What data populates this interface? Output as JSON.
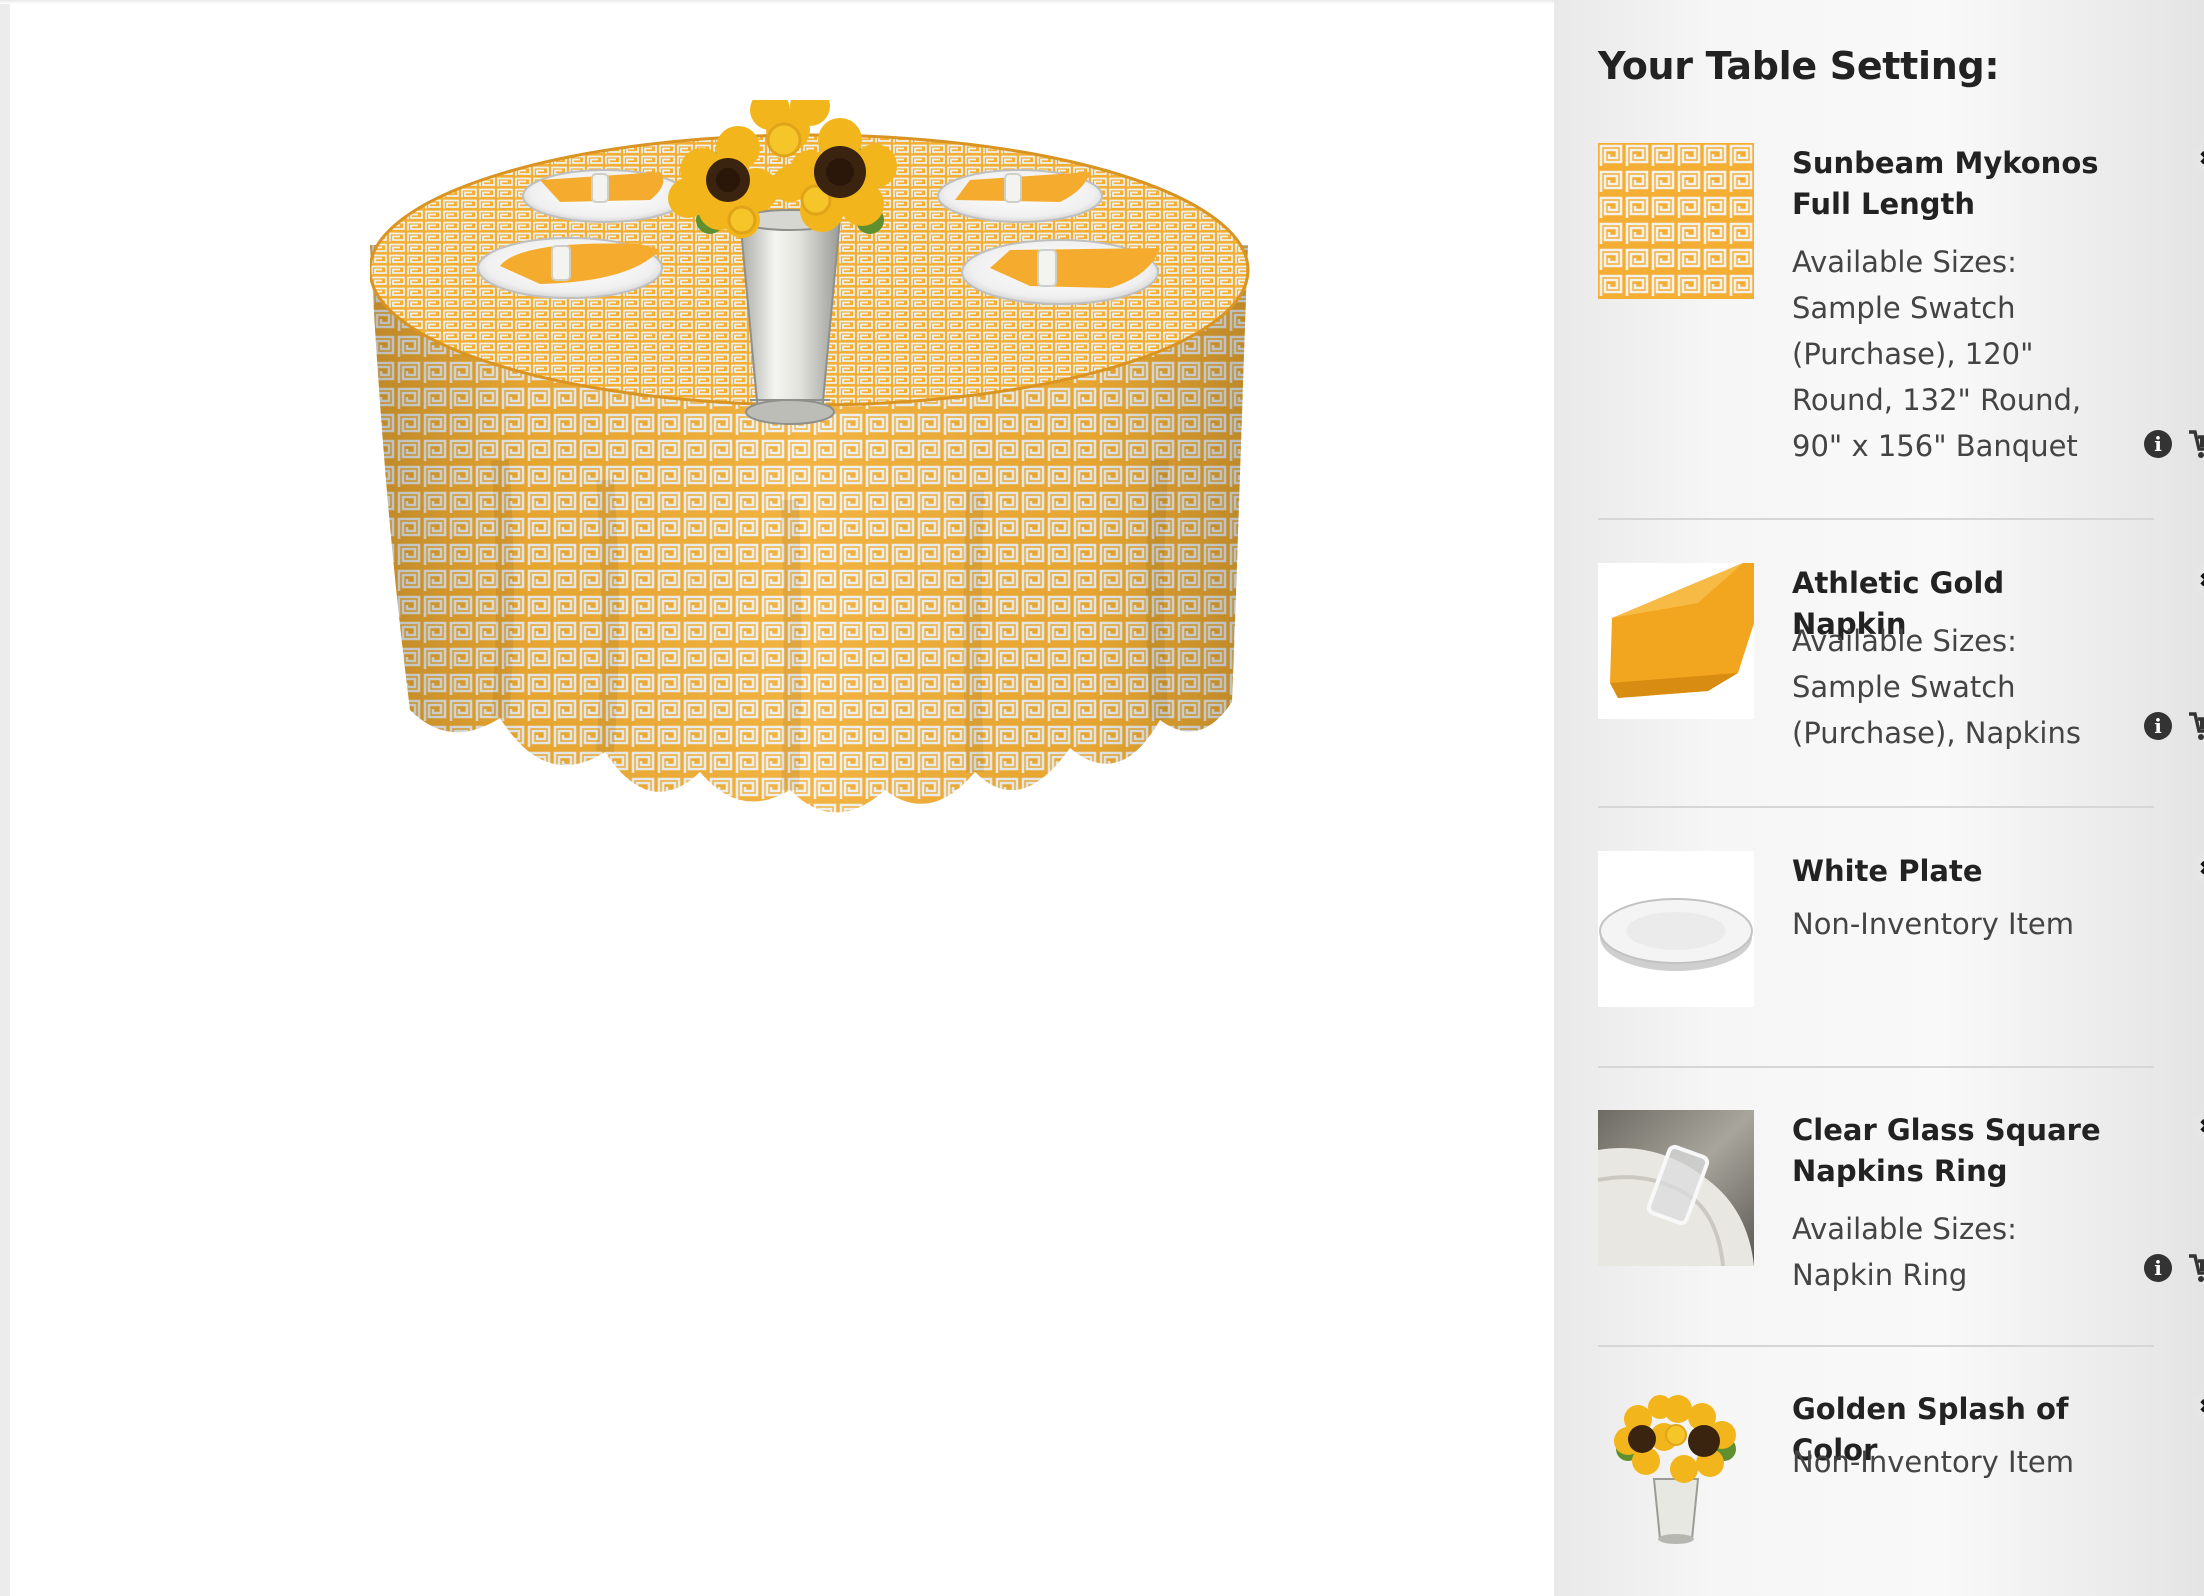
{
  "sidebar": {
    "title": "Your Table Setting:",
    "items": [
      {
        "name": "Sunbeam Mykonos Full Length",
        "thumb_icon": "mykonos-pattern-swatch",
        "sizes_label": "Available Sizes:",
        "sizes": "Sample Swatch (Purchase), 120\" Round, 132\" Round, 90\" x 156\" Banquet",
        "remove_glyph": "✖",
        "info_glyph": "i"
      },
      {
        "name": "Athletic Gold Napkin",
        "thumb_icon": "gold-napkin",
        "sizes_label": "Available Sizes:",
        "sizes": "Sample Swatch (Purchase), Napkins",
        "remove_glyph": "✖",
        "info_glyph": "i"
      },
      {
        "name": "White Plate",
        "thumb_icon": "white-plate",
        "status": "Non-Inventory Item",
        "remove_glyph": "✖"
      },
      {
        "name": "Clear Glass Square Napkins Ring",
        "thumb_icon": "glass-napkin-ring",
        "sizes_label": "Available Sizes:",
        "sizes": "Napkin Ring",
        "remove_glyph": "✖",
        "info_glyph": "i"
      },
      {
        "name": "Golden Splash of Color",
        "thumb_icon": "sunflower-bouquet",
        "status": "Non-Inventory Item",
        "remove_glyph": "✖"
      }
    ]
  },
  "colors": {
    "gold": "#f3ae33",
    "pattern_light": "#eef1ee",
    "text_dark": "#222222",
    "text_muted": "#444444",
    "sidebar_bg": "#f4f4f4"
  }
}
